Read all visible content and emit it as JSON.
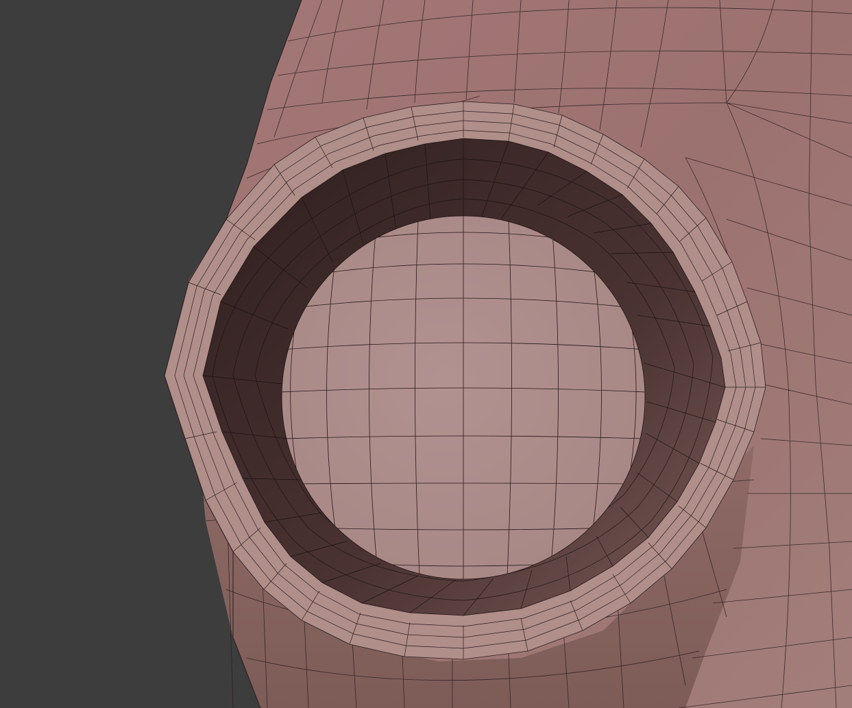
{
  "scene": {
    "background_color": "#3d3d3d",
    "mesh_color": "#a07878",
    "wire_color": "#1e1414",
    "socket_dark_color": "#3a2626",
    "eyeball_color": "#ad8d8b",
    "lid_color": "#b08f8b",
    "subject": "mesh-eye-socket-wireframe"
  }
}
